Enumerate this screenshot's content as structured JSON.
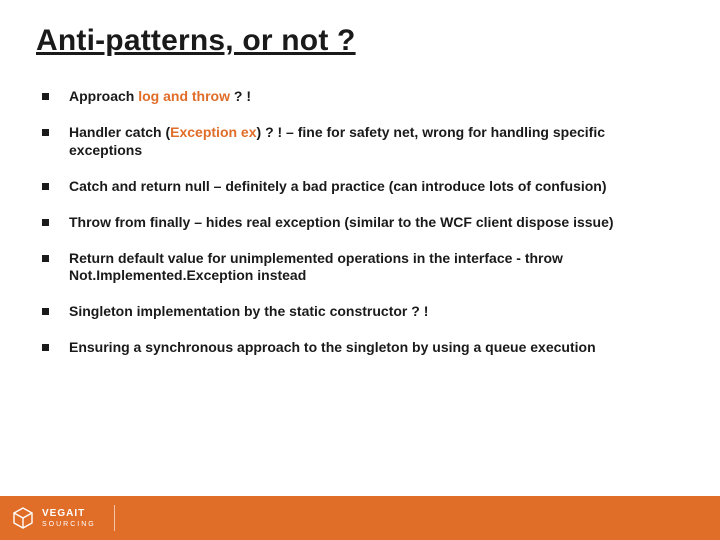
{
  "title": "Anti-patterns, or not ?",
  "bullets": [
    {
      "pre": "Approach ",
      "hl": "log and throw",
      "post": " ? !"
    },
    {
      "pre": "Handler catch (",
      "hl": "Exception ex",
      "post": ") ? ! – fine for safety net, wrong for handling specific exceptions"
    },
    {
      "pre": "Catch and return null – definitely a bad practice (can introduce lots of confusion)",
      "hl": "",
      "post": ""
    },
    {
      "pre": "Throw from finally – hides real exception (similar to the WCF client dispose issue)",
      "hl": "",
      "post": ""
    },
    {
      "pre": "Return default value for unimplemented operations in the interface - throw Not.Implemented.Exception instead",
      "hl": "",
      "post": ""
    },
    {
      "pre": "Singleton implementation by the static constructor ? !",
      "hl": "",
      "post": ""
    },
    {
      "pre": "Ensuring a synchronous approach to the singleton by using a queue execution",
      "hl": "",
      "post": ""
    }
  ],
  "footer": {
    "logo_line1": "VEGAIT",
    "logo_line2": "SOURCING"
  }
}
